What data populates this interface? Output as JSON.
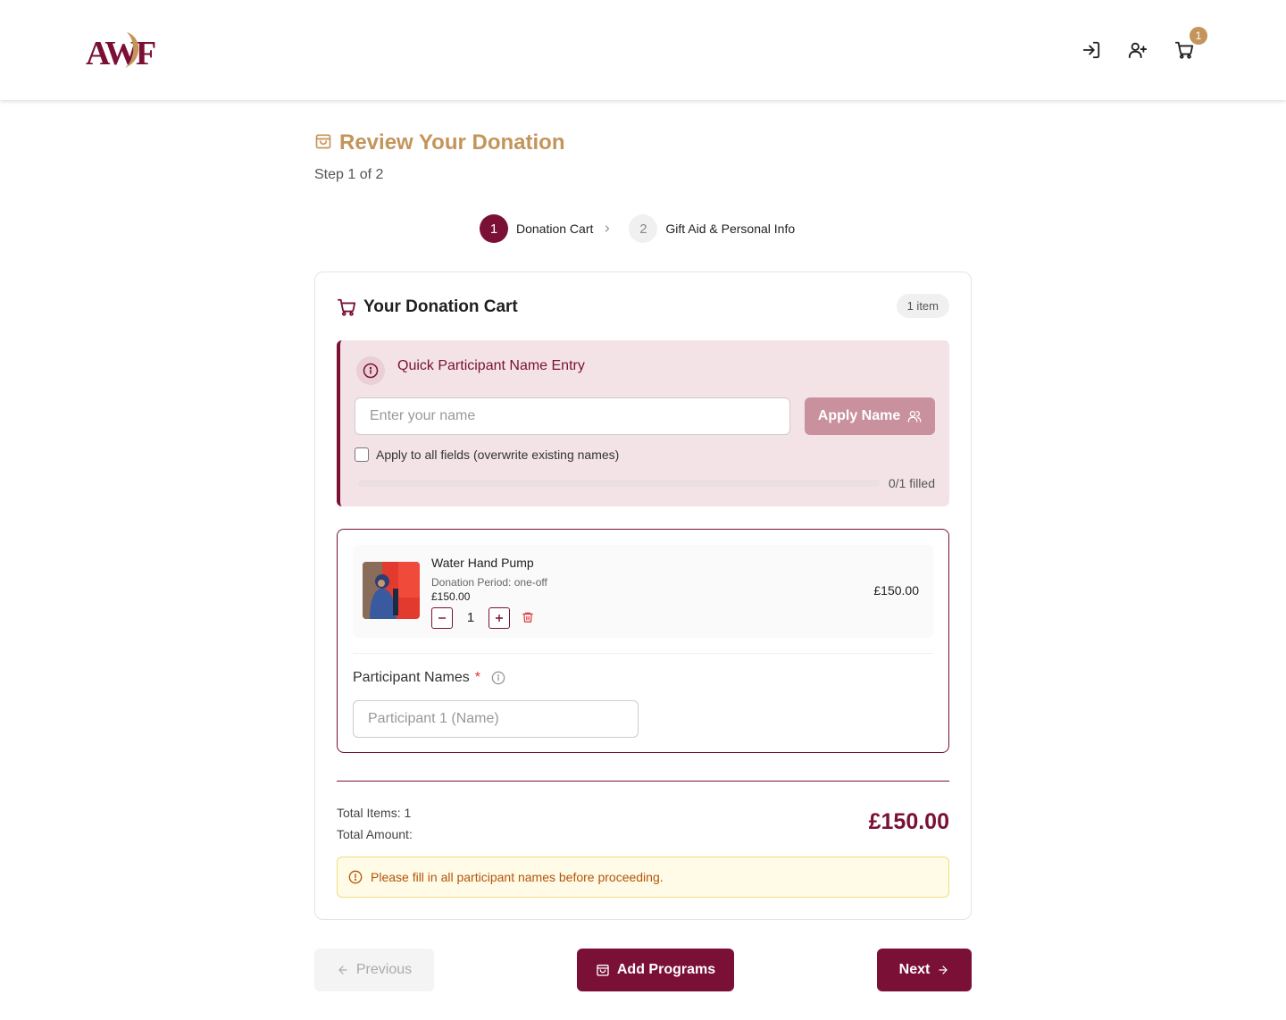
{
  "header": {
    "logo_text": "AWF",
    "cart_count": "1"
  },
  "page": {
    "title": "Review Your Donation",
    "step_text": "Step 1 of 2"
  },
  "stepper": {
    "steps": [
      {
        "number": "1",
        "label": "Donation Cart"
      },
      {
        "number": "2",
        "label": "Gift Aid & Personal Info"
      }
    ]
  },
  "cart": {
    "title": "Your Donation Cart",
    "count_label": "1 item",
    "quick_entry": {
      "title": "Quick Participant Name Entry",
      "placeholder": "Enter your name",
      "apply_label": "Apply Name",
      "apply_all_label": "Apply to all fields (overwrite existing names)",
      "progress_fraction": 0,
      "filled_label": "0/1 filled"
    },
    "items": [
      {
        "name": "Water Hand Pump",
        "period": "Donation Period: one-off",
        "unit_price": "£150.00",
        "quantity": "1",
        "line_total": "£150.00"
      }
    ],
    "participants": {
      "label": "Participant Names",
      "required_mark": "*",
      "placeholder": "Participant 1 (Name)"
    },
    "summary": {
      "total_items": "Total Items: 1",
      "total_amount_label": "Total Amount:",
      "total_amount": "£150.00"
    },
    "warning": "Please fill in all participant names before proceeding."
  },
  "nav": {
    "previous_label": "Previous",
    "add_programs_label": "Add Programs",
    "next_label": "Next"
  },
  "colors": {
    "brand": "#7a1035",
    "accent_gold": "#c4955a",
    "warning_text": "#b45309"
  }
}
